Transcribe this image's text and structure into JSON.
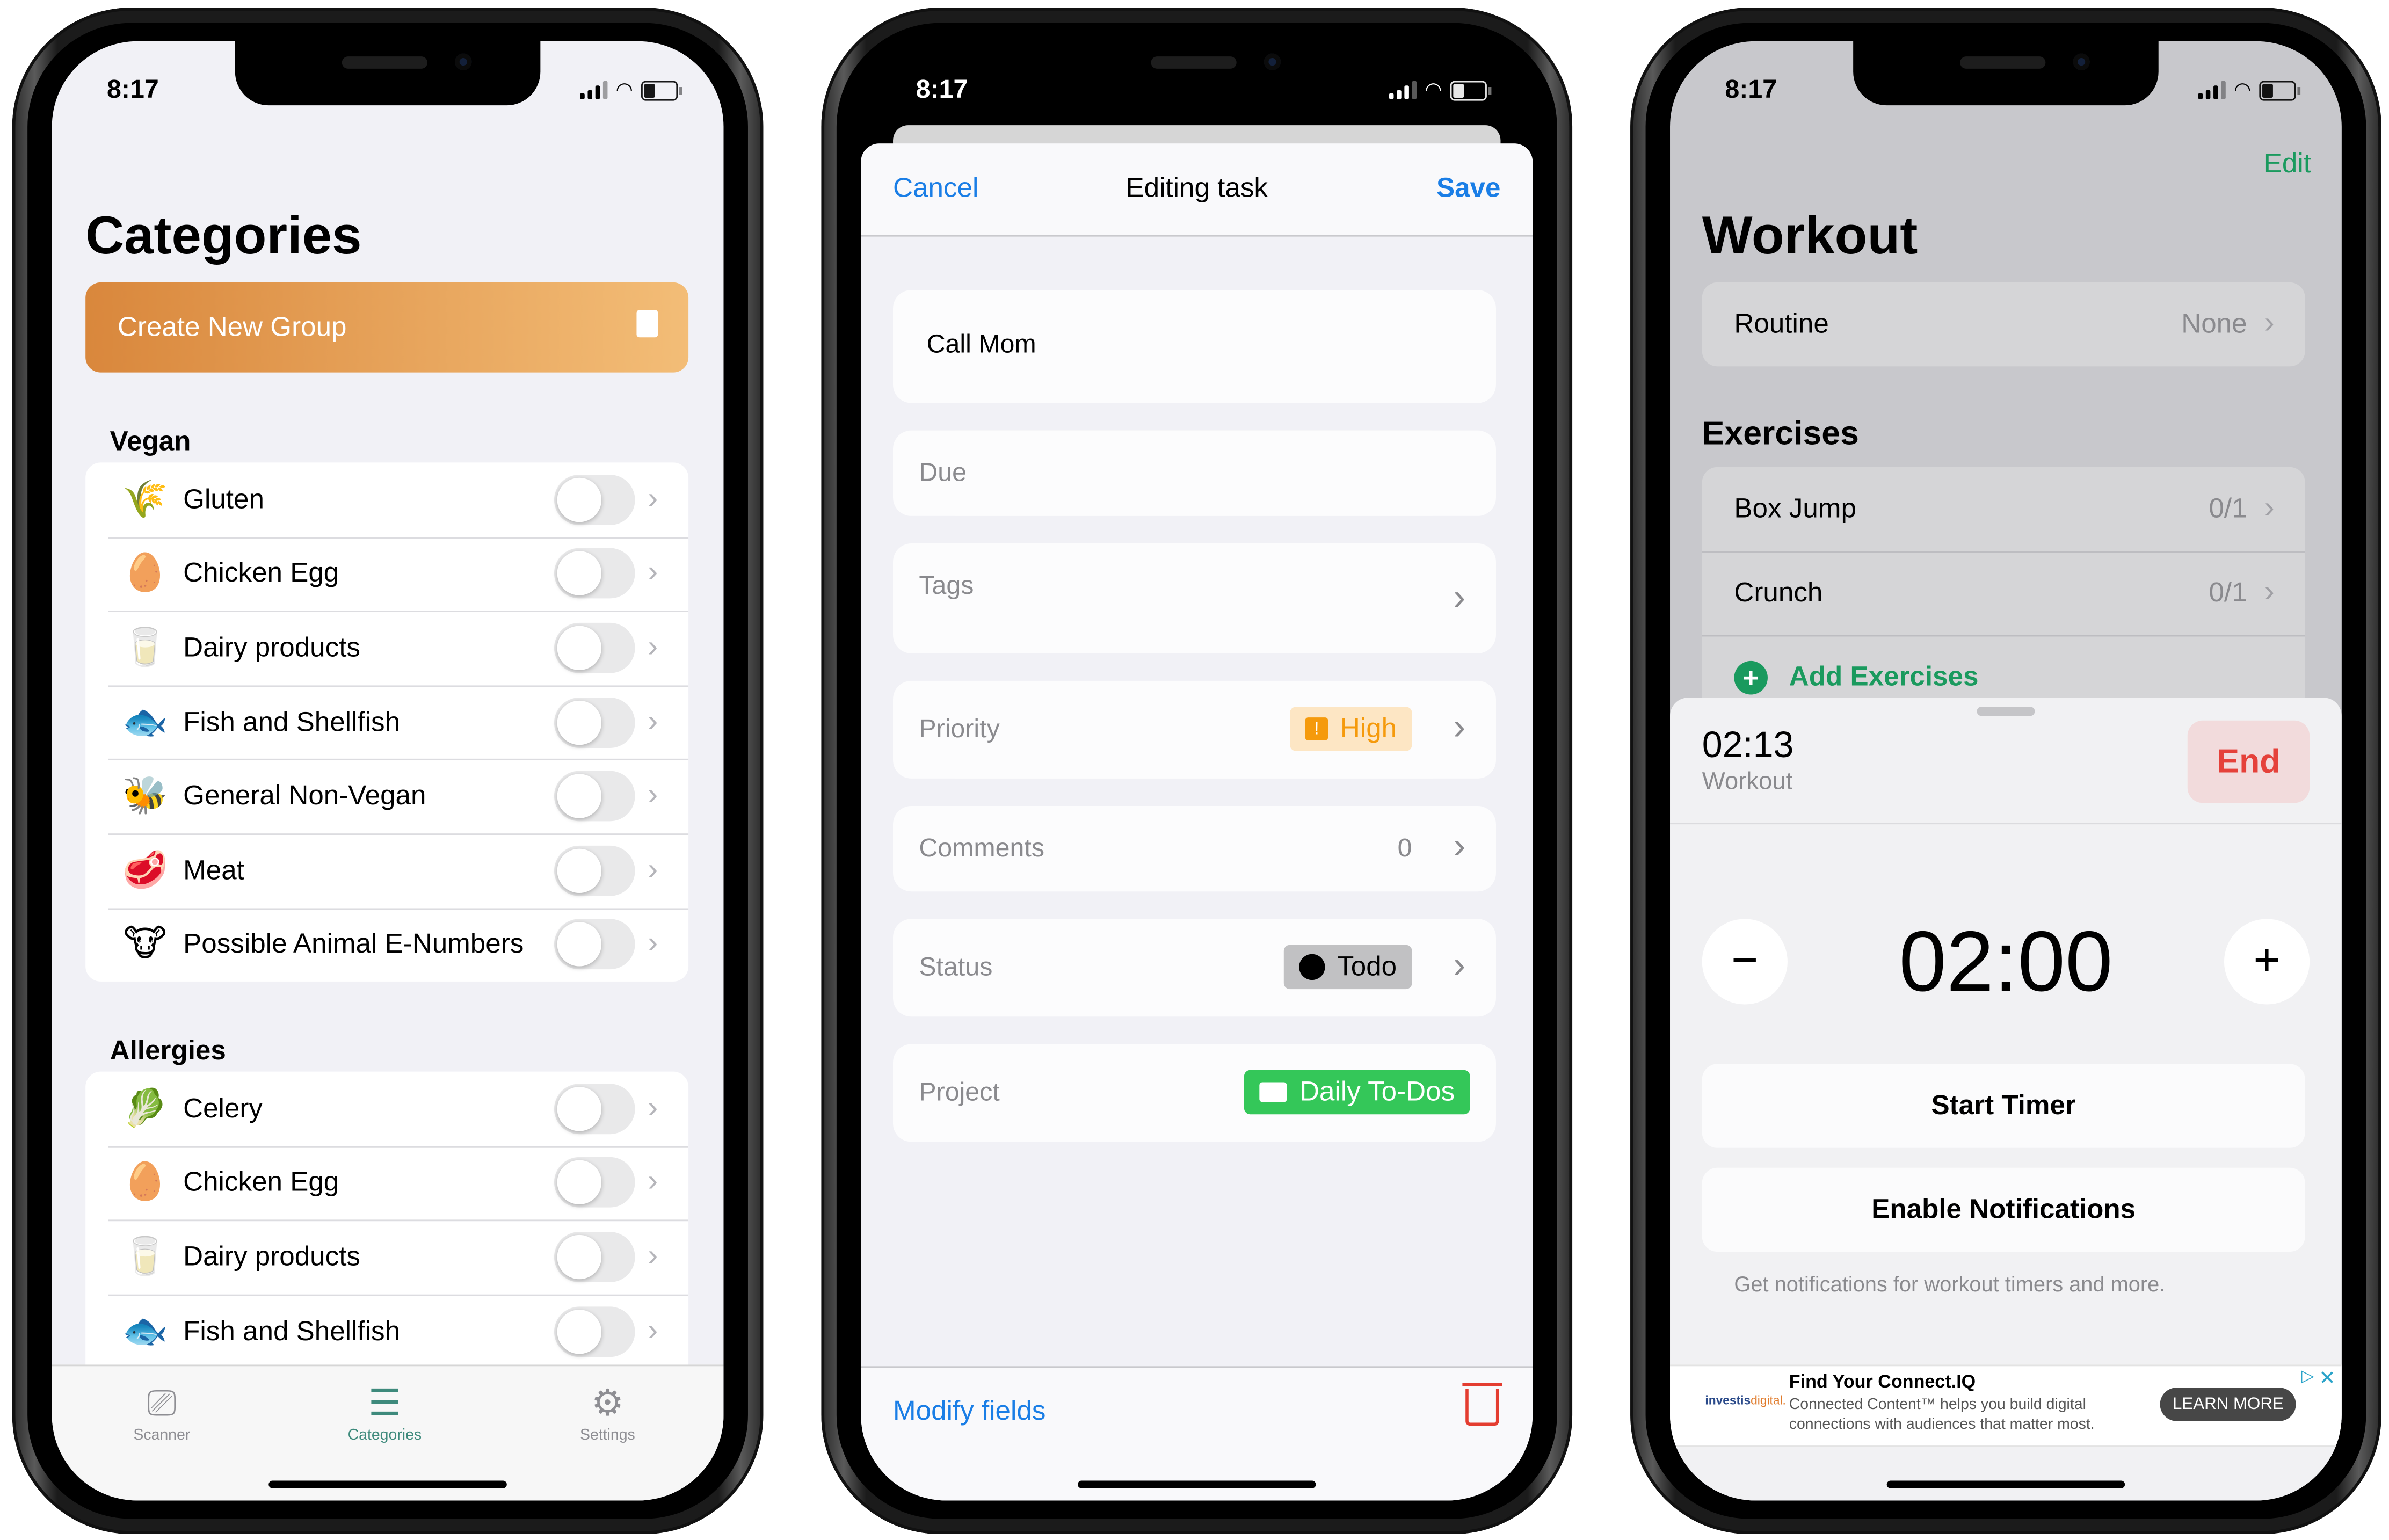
{
  "status_bar": {
    "time": "8:17"
  },
  "phone1": {
    "title": "Categories",
    "create_button": "Create New Group",
    "sections": [
      {
        "header": "Vegan",
        "items": [
          {
            "emoji": "🌾",
            "label": "Gluten",
            "enabled": false
          },
          {
            "emoji": "🥚",
            "label": "Chicken Egg",
            "enabled": false
          },
          {
            "emoji": "🥛",
            "label": "Dairy products",
            "enabled": false
          },
          {
            "emoji": "🐟",
            "label": "Fish and Shellfish",
            "enabled": false
          },
          {
            "emoji": "🐝",
            "label": "General Non-Vegan",
            "enabled": false
          },
          {
            "emoji": "🥩",
            "label": "Meat",
            "enabled": false
          },
          {
            "emoji": "🐮",
            "label": "Possible Animal E-Numbers",
            "enabled": false
          }
        ]
      },
      {
        "header": "Allergies",
        "items": [
          {
            "emoji": "🥬",
            "label": "Celery",
            "enabled": false
          },
          {
            "emoji": "🥚",
            "label": "Chicken Egg",
            "enabled": false
          },
          {
            "emoji": "🥛",
            "label": "Dairy products",
            "enabled": false
          },
          {
            "emoji": "🐟",
            "label": "Fish and Shellfish",
            "enabled": false
          }
        ]
      }
    ],
    "tabs": [
      {
        "label": "Scanner",
        "icon": "scanner-icon",
        "glyph": "⎚",
        "active": false
      },
      {
        "label": "Categories",
        "icon": "list-icon",
        "glyph": "☰",
        "active": true
      },
      {
        "label": "Settings",
        "icon": "gear-icon",
        "glyph": "⚙",
        "active": false
      }
    ]
  },
  "phone2": {
    "nav": {
      "cancel": "Cancel",
      "title": "Editing task",
      "save": "Save"
    },
    "task_name": "Call Mom",
    "fields": {
      "due": "Due",
      "tags": "Tags",
      "priority": {
        "label": "Priority",
        "value": "High",
        "icon": "!"
      },
      "comments": {
        "label": "Comments",
        "value": "0"
      },
      "status": {
        "label": "Status",
        "value": "Todo"
      },
      "project": {
        "label": "Project",
        "value": "Daily To-Dos"
      }
    },
    "bottom": {
      "modify": "Modify fields"
    },
    "colors": {
      "accent": "#1a7ee6",
      "priority": "#f59a0c",
      "project": "#34c759",
      "delete": "#e43d30"
    }
  },
  "phone3": {
    "edit": "Edit",
    "title": "Workout",
    "routine": {
      "label": "Routine",
      "value": "None"
    },
    "exercises_header": "Exercises",
    "exercises": [
      {
        "name": "Box Jump",
        "progress": "0/1"
      },
      {
        "name": "Crunch",
        "progress": "0/1"
      }
    ],
    "add_exercises": "Add Exercises",
    "panel": {
      "elapsed": "02:13",
      "subtitle": "Workout",
      "end": "End",
      "timer": "02:00",
      "minus": "−",
      "plus": "+",
      "start_timer": "Start Timer",
      "enable_notifications": "Enable Notifications",
      "note": "Get notifications for workout timers and more."
    },
    "ad": {
      "logo_a": "investis",
      "logo_b": "digital.",
      "headline": "Find Your Connect.IQ",
      "body": "Connected Content™ helps you build digital connections with audiences that matter most.",
      "cta": "LEARN MORE",
      "close": "✕",
      "adchoices": "▷"
    },
    "colors": {
      "accent": "#1a9a5e",
      "end": "#e5413a"
    }
  }
}
